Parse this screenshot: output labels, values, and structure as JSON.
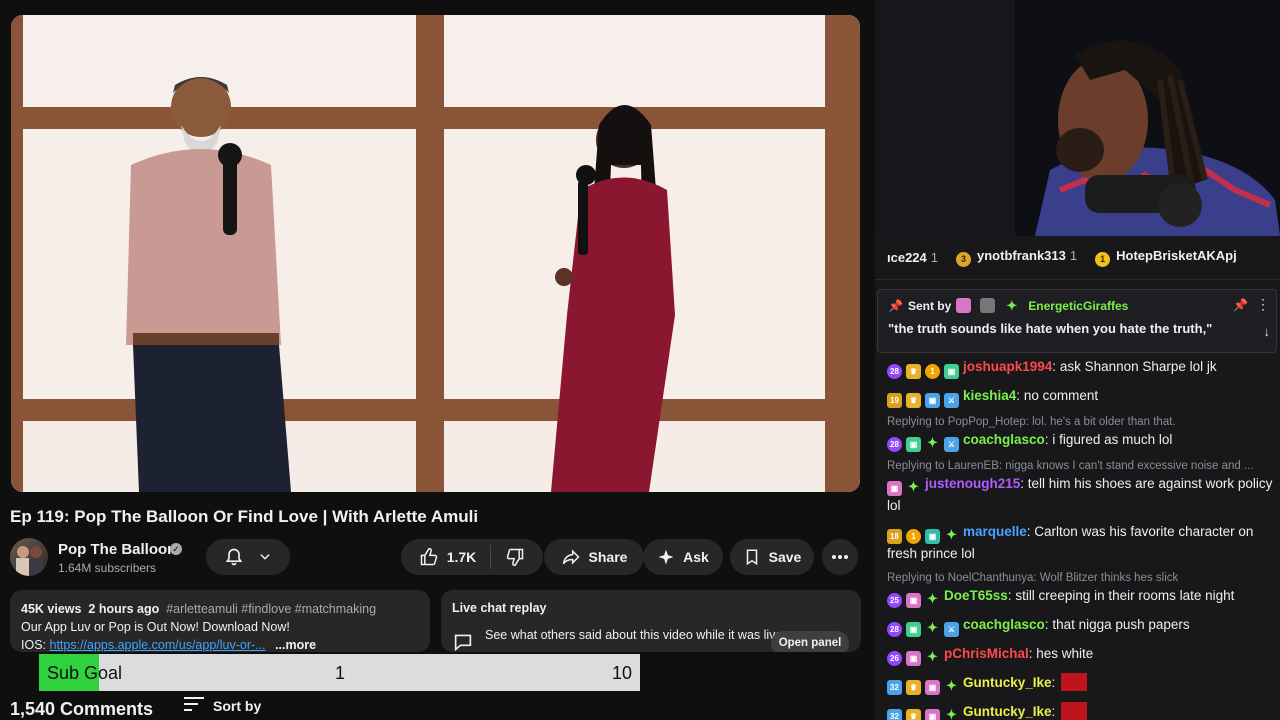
{
  "video": {
    "title": "Ep 119: Pop The Balloon Or Find Love | With Arlette Amuli",
    "channel_name": "Pop The Balloon",
    "subscribers": "1.64M subscribers",
    "likes": "1.7K",
    "share_label": "Share",
    "ask_label": "Ask",
    "save_label": "Save"
  },
  "description": {
    "views": "45K views",
    "age": "2 hours ago",
    "tags": "#arletteamuli #findlove #matchmaking",
    "line2": "Our App Luv or Pop is Out Now! Download Now!",
    "ios_label": "IOS:",
    "ios_link": "https://apps.apple.com/us/app/luv-or-...",
    "more": "...more"
  },
  "live_chat_replay": {
    "title": "Live chat replay",
    "text": "See what others said about this video while it was live.",
    "button": "Open panel"
  },
  "sub_goal": {
    "label": "Sub Goal",
    "current": "1",
    "target": "10",
    "progress": 0.1
  },
  "comments": {
    "count": "1,540 Comments",
    "sort_label": "Sort by"
  },
  "chat": {
    "leaderboard": [
      {
        "name": "ıce224",
        "count": "1"
      },
      {
        "name": "ynotbfrank313",
        "count": "1"
      },
      {
        "name": "HotepBrisketAKApj",
        "count": ""
      }
    ],
    "pinned": {
      "sent_by": "Sent by",
      "sender": "EnergeticGiraffes",
      "message": "\"the truth sounds like hate when you hate the truth,\""
    },
    "messages": [
      {
        "user": "joshuapk1994",
        "color": "#ff4a4a",
        "text": "ask Shannon Sharpe lol jk"
      },
      {
        "user": "kieshia4",
        "color": "#7cf04a",
        "text": "no comment"
      },
      {
        "reply": "Replying to PopPop_Hotep: lol. he's a bit older than that."
      },
      {
        "user": "coachglasco",
        "color": "#7cf04a",
        "text": "i figured as much lol"
      },
      {
        "reply": "Replying to LaurenEB: nigga knows I can't stand excessive noise and ..."
      },
      {
        "user": "justenough215",
        "color": "#b15cff",
        "text": "tell him his shoes are against work policy lol"
      },
      {
        "user": "marquelle",
        "color": "#4aa3ff",
        "text": "Carlton was his favorite character on fresh prince lol"
      },
      {
        "reply": "Replying to NoelChanthunya: Wolf Blitzer thinks hes slick"
      },
      {
        "user": "DoeT65ss",
        "color": "#7cf04a",
        "text": "still creeping in their rooms late night"
      },
      {
        "user": "coachglasco",
        "color": "#7cf04a",
        "text": "that nigga push papers"
      },
      {
        "user": "pChrisMichal",
        "color": "#ff4a4a",
        "text": "hes white"
      },
      {
        "user": "Guntucky_Ike",
        "color": "#e8f04a",
        "text": ""
      },
      {
        "user": "Guntucky_Ike",
        "color": "#e8f04a",
        "text": ""
      }
    ]
  }
}
